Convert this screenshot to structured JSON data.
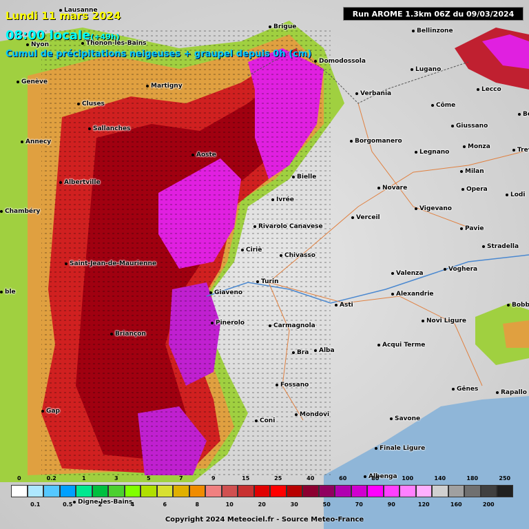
{
  "header": {
    "date": "Lundi 11 mars 2024",
    "time": "08:00 locale",
    "lead": "(+49h)",
    "variable": "Cumul de précipitations neigeuses + graupel depuis 0h (cm)",
    "run": "Run AROME 1.3km 06Z du 09/03/2024"
  },
  "cities": [
    {
      "name": "Lausanne"
    },
    {
      "name": "Nyon"
    },
    {
      "name": "Thonon-les-Bains"
    },
    {
      "name": "Genève"
    },
    {
      "name": "Brigue"
    },
    {
      "name": "Bellinzone"
    },
    {
      "name": "Domodossola"
    },
    {
      "name": "Lugano"
    },
    {
      "name": "Martigny"
    },
    {
      "name": "Verbania"
    },
    {
      "name": "Lecco"
    },
    {
      "name": "Côme"
    },
    {
      "name": "Cluses"
    },
    {
      "name": "Annecy"
    },
    {
      "name": "Sallanches"
    },
    {
      "name": "Giussano"
    },
    {
      "name": "Borgomanero"
    },
    {
      "name": "Aoste"
    },
    {
      "name": "Legnano"
    },
    {
      "name": "Monza"
    },
    {
      "name": "Milan"
    },
    {
      "name": "Albertville"
    },
    {
      "name": "Bielle"
    },
    {
      "name": "Novare"
    },
    {
      "name": "Opera"
    },
    {
      "name": "Lodi"
    },
    {
      "name": "Ivrée"
    },
    {
      "name": "Chambéry"
    },
    {
      "name": "Vigevano"
    },
    {
      "name": "Verceil"
    },
    {
      "name": "Pavie"
    },
    {
      "name": "Rivarolo Canavese"
    },
    {
      "name": "Stradella"
    },
    {
      "name": "Ciriè"
    },
    {
      "name": "Chivasso"
    },
    {
      "name": "Saint-Jean-de-Maurienne"
    },
    {
      "name": "Voghera"
    },
    {
      "name": "Valenza"
    },
    {
      "name": "Turin"
    },
    {
      "name": "Giaveno"
    },
    {
      "name": "Alexandrie"
    },
    {
      "name": "Asti"
    },
    {
      "name": "Bobbio"
    },
    {
      "name": "Novi Ligure"
    },
    {
      "name": "Pinerolo"
    },
    {
      "name": "Carmagnola"
    },
    {
      "name": "Briançon"
    },
    {
      "name": "Acqui Terme"
    },
    {
      "name": "Bra"
    },
    {
      "name": "Alba"
    },
    {
      "name": "Fossano"
    },
    {
      "name": "Gênes"
    },
    {
      "name": "Rapallo"
    },
    {
      "name": "Gap"
    },
    {
      "name": "Coni"
    },
    {
      "name": "Mondovi"
    },
    {
      "name": "Savone"
    },
    {
      "name": "Finale Ligure"
    },
    {
      "name": "Albenga"
    },
    {
      "name": "Digne-les-Bains"
    },
    {
      "name": "ble"
    },
    {
      "name": "Be"
    },
    {
      "name": "Trevi"
    }
  ],
  "legend": {
    "top_labels": [
      "0",
      "0.2",
      "1",
      "3",
      "5",
      "7",
      "9",
      "15",
      "25",
      "40",
      "60",
      "80",
      "100",
      "140",
      "180",
      "250"
    ],
    "bottom_labels": [
      "0.1",
      "0.5",
      "2",
      "4",
      "6",
      "8",
      "10",
      "20",
      "30",
      "50",
      "70",
      "90",
      "120",
      "160",
      "200"
    ],
    "colors": [
      "#ffffff",
      "#aee8ff",
      "#55c8ff",
      "#00a0ff",
      "#00e890",
      "#00c040",
      "#4cd030",
      "#80ff00",
      "#b0e000",
      "#d8e030",
      "#e0b000",
      "#f08c00",
      "#f08080",
      "#d05050",
      "#c83030",
      "#e00000",
      "#ff0000",
      "#b80000",
      "#8c0030",
      "#900060",
      "#b000b0",
      "#d000d0",
      "#ff00ff",
      "#ff40ff",
      "#ff80ff",
      "#ffb0ff",
      "#d0d0d0",
      "#a0a0a0",
      "#707070",
      "#404040",
      "#202020"
    ]
  },
  "footer": {
    "copyright": "Copyright 2024 Meteociel.fr - Source Meteo-France"
  }
}
